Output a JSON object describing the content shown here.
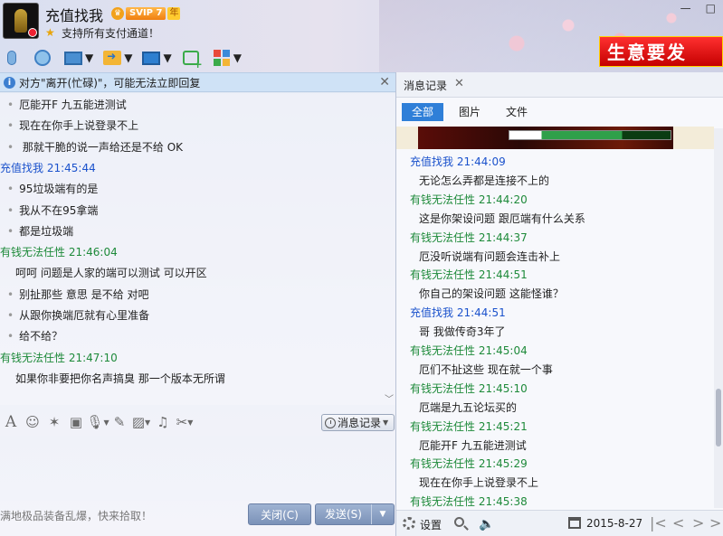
{
  "header": {
    "contact_name": "充值找我",
    "vip_badge": "SVIP 7",
    "vip_year": "年",
    "signature": "支持所有支付通道！",
    "promo_text": "生意要发",
    "window_controls": [
      "—",
      "□"
    ]
  },
  "notice": {
    "text": "对方\"离开(忙碌)\"，可能无法立即回复",
    "close": "✕"
  },
  "chat": {
    "rows": [
      {
        "kind": "msg",
        "text": "厄能开F 九五能进测试"
      },
      {
        "kind": "msg",
        "text": "现在在你手上说登录不上"
      },
      {
        "kind": "msg",
        "text": " 那就干脆的说一声给还是不给  OK"
      },
      {
        "kind": "sender-blue",
        "text": "充值找我   21:45:44"
      },
      {
        "kind": "msg",
        "text": "95垃圾端有的是"
      },
      {
        "kind": "msg",
        "text": "我从不在95拿端"
      },
      {
        "kind": "msg",
        "text": "都是垃圾端"
      },
      {
        "kind": "sender-green",
        "text": "有钱无法任性   21:46:04"
      },
      {
        "kind": "msg-plain",
        "text": "呵呵 问题是人家的端可以测试 可以开区"
      },
      {
        "kind": "msg",
        "text": "别扯那些 意思 是不给 对吧"
      },
      {
        "kind": "msg",
        "text": "从跟你换端厄就有心里准备"
      },
      {
        "kind": "msg",
        "text": "给不给？"
      },
      {
        "kind": "sender-green",
        "text": "有钱无法任性   21:47:10"
      },
      {
        "kind": "msg-plain",
        "text": "如果你非要把你名声搞臭 那一个版本无所谓"
      }
    ]
  },
  "input": {
    "history_button": "消息记录",
    "ticker": "满地极品装备乱爆，快来拾取！",
    "close_button": "关闭(C)",
    "send_button": "发送(S)"
  },
  "history": {
    "tab_label": "消息记录",
    "tab_close": "✕",
    "filters": [
      "全部",
      "图片",
      "文件"
    ],
    "active_filter": "全部",
    "rows": [
      {
        "kind": "sender-blue",
        "text": "充值找我 21:44:09"
      },
      {
        "kind": "msg",
        "text": "无论怎么弄都是连接不上的"
      },
      {
        "kind": "sender-green",
        "text": "有钱无法任性 21:44:20"
      },
      {
        "kind": "msg",
        "text": "这是你架设问题 跟厄端有什么关系"
      },
      {
        "kind": "sender-green",
        "text": "有钱无法任性 21:44:37"
      },
      {
        "kind": "msg",
        "text": "厄没听说端有问题会连击补上"
      },
      {
        "kind": "sender-green",
        "text": "有钱无法任性 21:44:51"
      },
      {
        "kind": "msg",
        "text": "你自己的架设问题 这能怪谁？"
      },
      {
        "kind": "sender-blue",
        "text": "充值找我 21:44:51"
      },
      {
        "kind": "msg",
        "text": "哥 我做传奇3年了"
      },
      {
        "kind": "sender-green",
        "text": "有钱无法任性 21:45:04"
      },
      {
        "kind": "msg",
        "text": "厄们不扯这些  现在就一个事"
      },
      {
        "kind": "sender-green",
        "text": "有钱无法任性 21:45:10"
      },
      {
        "kind": "msg",
        "text": "厄端是九五论坛买的"
      },
      {
        "kind": "sender-green",
        "text": "有钱无法任性 21:45:21"
      },
      {
        "kind": "msg",
        "text": "厄能开F 九五能进测试"
      },
      {
        "kind": "sender-green",
        "text": "有钱无法任性 21:45:29"
      },
      {
        "kind": "msg",
        "text": "现在在你手上说登录不上"
      },
      {
        "kind": "sender-green",
        "text": "有钱无法任性 21:45:38"
      }
    ],
    "footer": {
      "settings_label": "设置",
      "date": "2015-8-27"
    }
  },
  "colors": {
    "sender_self": "#1b52cc",
    "sender_other": "#1e8a3a",
    "active_tab": "#2f7fd8"
  }
}
